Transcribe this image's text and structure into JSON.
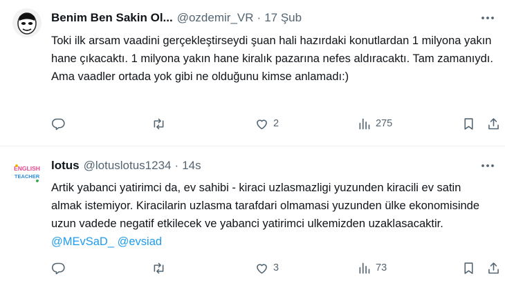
{
  "tweets": [
    {
      "author_name": "Benim Ben Sakin Ol...",
      "handle": "@ozdemir_VR",
      "dot": "·",
      "time": "17 Şub",
      "text": "Toki ilk arsam vaadini gerçekleştirseydi şuan hali hazırdaki konutlardan 1 milyona yakın hane çıkacaktı. 1 milyona yakın hane kiralık pazarına nefes aldıracaktı. Tam zamanıydı. Ama vaadler ortada yok gibi ne olduğunu kimse anlamadı:)",
      "mentions": [],
      "likes": "2",
      "views": "275",
      "avatar_icon": "masked-face-avatar"
    },
    {
      "author_name": "lotus",
      "handle": "@lotuslotus1234",
      "dot": "·",
      "time": "14s",
      "text": "Artik yabanci yatirimci da, ev sahibi - kiraci uzlasmazligi yuzunden kiracili ev satin almak istemiyor. Kiracilarin uzlasma tarafdari olmamasi yuzunden ülke ekonomisinde uzun vadede negatif etkilecek ve yabanci yatirimci ulkemizden uzaklasacaktir.",
      "mentions": [
        "@MEvSaD_",
        "@evsiad"
      ],
      "likes": "3",
      "views": "73",
      "avatar_icon": "english-teacher-avatar",
      "avatar_text": "ENGLISH TEACHER"
    }
  ],
  "colors": {
    "text": "#0f1419",
    "muted": "#536471",
    "link": "#1d9bf0",
    "divider": "#eff3f4"
  }
}
